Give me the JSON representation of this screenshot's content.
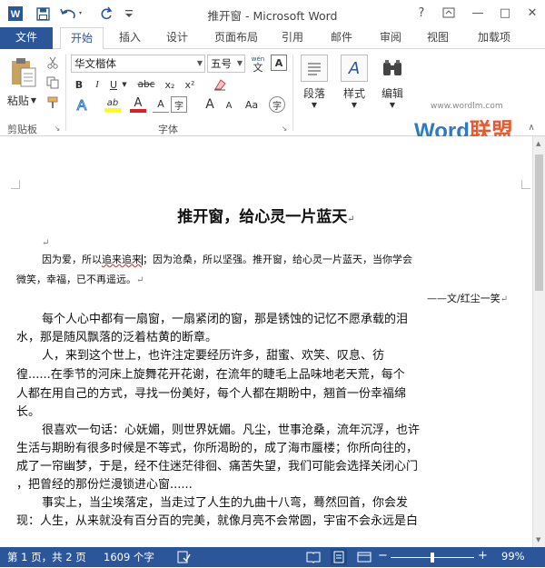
{
  "window": {
    "title": "推开窗 - Microsoft Word",
    "help": "?",
    "minimize": "—",
    "restore": "□",
    "close": "✕"
  },
  "tabs": [
    "文件",
    "开始",
    "插入",
    "设计",
    "页面布局",
    "引用",
    "邮件",
    "审阅",
    "视图",
    "加载项"
  ],
  "ribbon": {
    "paste_label": "粘贴",
    "clipboard_group": "剪贴板",
    "font_name": "华文楷体",
    "font_size": "五号",
    "wen_label": "wén",
    "wen_glyph": "文",
    "font_group": "字体",
    "paragraph_label": "段落",
    "style_label": "样式",
    "edit_label": "编辑",
    "style_glyph": "A",
    "btn_bold": "B",
    "btn_italic": "I",
    "btn_underline": "U",
    "btn_strike": "abc",
    "btn_sub": "x₂",
    "btn_sup": "x²",
    "btn_grow": "A",
    "btn_shrink": "A",
    "btn_case": "Aa",
    "btn_font_color": "A",
    "btn_highlight": "ab"
  },
  "watermark": {
    "url": "www.wordlm.com",
    "brand_word": "Word",
    "brand_cn": "联盟"
  },
  "document": {
    "title": "推开窗，给心灵一片蓝天",
    "intro_line1_part1": "因为爱，所以",
    "intro_line1_wavy": "追来追来",
    "intro_line1_part2": "；因为沧桑，所以坚强。推开窗，给心灵一片蓝天，当你学会",
    "intro_line2": "微笑，幸福，已不再遥远。",
    "signature": "——文/红尘一笑",
    "body_lines": [
      "每个人心中都有一扇窗，一扇紧闭的窗，那是锈蚀的记忆不愿承载的泪",
      "水，那是随风飘落的泛着枯黄的断章。",
      "人，来到这个世上，也许注定要经历许多，甜蜜、欢笑、叹息、彷",
      "徨......在季节的河床上旋舞花开花谢，在流年的睫毛上品味地老天荒，每个",
      "人都在用自己的方式，寻找一份美好，每个人都在期盼中，翘首一份幸福绵",
      "长。",
      "很喜欢一句话：心妩媚，则世界妩媚。凡尘，世事沧桑，流年沉浮，也许",
      "生活与期盼有很多时候是不等式，你所渴盼的，成了海市蜃楼；你所向往的，",
      "成了一帘幽梦，于是，经不住迷茫徘徊、痛苦失望，我们可能会选择关闭心门",
      "，把曾经的那份烂漫锁进心窗......",
      "事实上，当尘埃落定，当走过了人生的九曲十八弯，蓦然回首，你会发",
      "现：人生，从来就没有百分百的完美，就像月亮不会常圆，宇宙不会永远是白"
    ]
  },
  "status": {
    "page": "第 1 页，共 2 页",
    "words": "1609 个字",
    "zoom": "99%",
    "zoom_minus": "−",
    "zoom_plus": "+"
  }
}
